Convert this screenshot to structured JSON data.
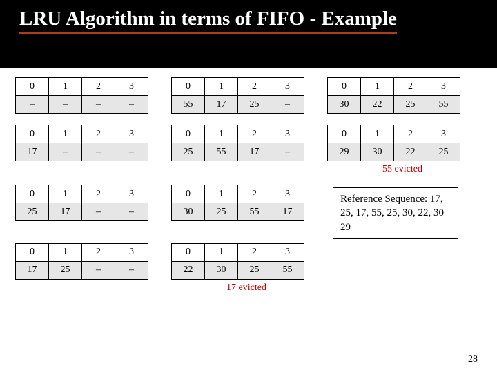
{
  "title": "LRU Algorithm in terms of FIFO - Example",
  "page_number": "28",
  "tables": {
    "r1c1": {
      "h": [
        "0",
        "1",
        "2",
        "3"
      ],
      "v": [
        "–",
        "–",
        "–",
        "–"
      ]
    },
    "r1c2": {
      "h": [
        "0",
        "1",
        "2",
        "3"
      ],
      "v": [
        "55",
        "17",
        "25",
        "–"
      ]
    },
    "r1c3": {
      "h": [
        "0",
        "1",
        "2",
        "3"
      ],
      "v": [
        "30",
        "22",
        "25",
        "55"
      ]
    },
    "r2c1": {
      "h": [
        "0",
        "1",
        "2",
        "3"
      ],
      "v": [
        "17",
        "–",
        "–",
        "–"
      ]
    },
    "r2c2": {
      "h": [
        "0",
        "1",
        "2",
        "3"
      ],
      "v": [
        "25",
        "55",
        "17",
        "–"
      ]
    },
    "r2c3": {
      "h": [
        "0",
        "1",
        "2",
        "3"
      ],
      "v": [
        "29",
        "30",
        "22",
        "25"
      ]
    },
    "r3c1": {
      "h": [
        "0",
        "1",
        "2",
        "3"
      ],
      "v": [
        "25",
        "17",
        "–",
        "–"
      ]
    },
    "r3c2": {
      "h": [
        "0",
        "1",
        "2",
        "3"
      ],
      "v": [
        "30",
        "25",
        "55",
        "17"
      ]
    },
    "r4c1": {
      "h": [
        "0",
        "1",
        "2",
        "3"
      ],
      "v": [
        "17",
        "25",
        "–",
        "–"
      ]
    },
    "r4c2": {
      "h": [
        "0",
        "1",
        "2",
        "3"
      ],
      "v": [
        "22",
        "30",
        "25",
        "55"
      ]
    }
  },
  "captions": {
    "evicted55": "55 evicted",
    "evicted17": "17 evicted"
  },
  "ref_sequence": "Reference Sequence: 17, 25, 17, 55, 25, 30, 22, 30 29"
}
